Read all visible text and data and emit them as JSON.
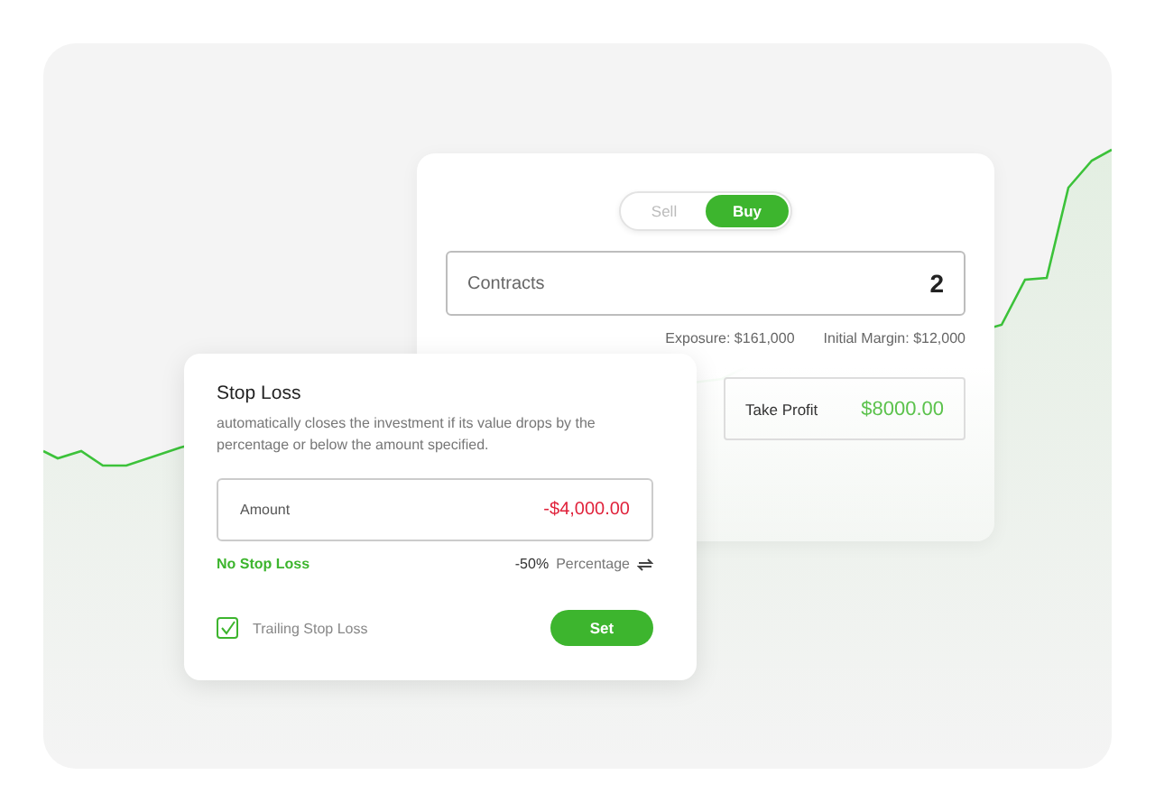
{
  "order_card": {
    "toggle": [
      {
        "label": "Sell",
        "selected": false
      },
      {
        "label": "Buy",
        "selected": true
      }
    ],
    "contracts": {
      "label": "Contracts",
      "value": "2"
    },
    "exposure": "Exposure: $161,000",
    "initial_margin": "Initial Margin: $12,000",
    "take_profit": {
      "label": "Take Profit",
      "value": "$8000.00"
    }
  },
  "stop_loss_dialog": {
    "title": "Stop Loss",
    "description": "automatically closes the investment if its value drops by the percentage or below the amount specified.",
    "amount": {
      "label": "Amount",
      "value": "-$4,000.00"
    },
    "no_stop_loss": "No Stop Loss",
    "percentage_value": "-50%",
    "percentage_label": "Percentage",
    "trailing_stop_loss": {
      "label": "Trailing Stop Loss",
      "checked": true
    },
    "set_button": "Set"
  }
}
